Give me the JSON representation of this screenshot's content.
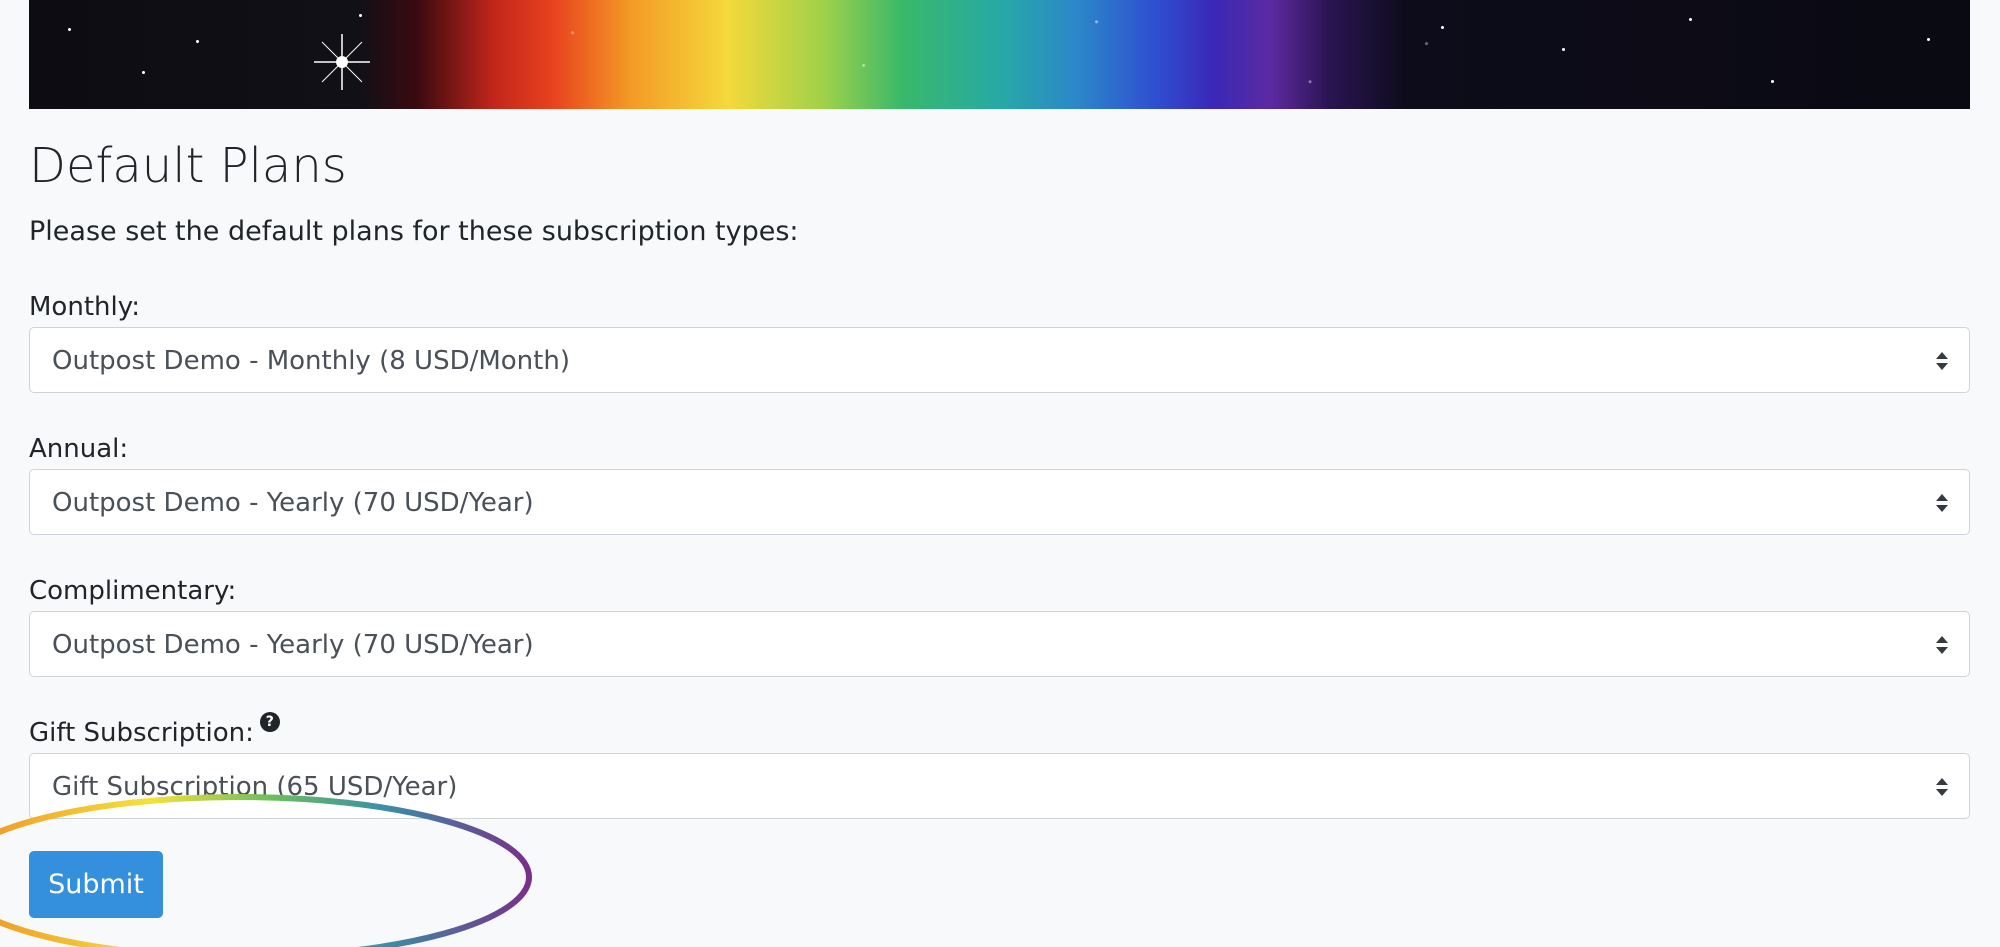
{
  "heading": "Default Plans",
  "intro": "Please set the default plans for these subscription types:",
  "fields": [
    {
      "label": "Monthly:",
      "value": "Outpost Demo - Monthly (8 USD/Month)"
    },
    {
      "label": "Annual:",
      "value": "Outpost Demo - Yearly (70 USD/Year)"
    },
    {
      "label": "Complimentary:",
      "value": "Outpost Demo - Yearly (70 USD/Year)"
    },
    {
      "label": "Gift Subscription:",
      "value": "Gift Subscription (65 USD/Year)"
    }
  ],
  "help_icon": {
    "glyph": "?",
    "icon": "question-circle-icon"
  },
  "submit_label": "Submit",
  "colors": {
    "primary": "#3490dc",
    "background": "#f8f9fa",
    "text": "#212529"
  }
}
